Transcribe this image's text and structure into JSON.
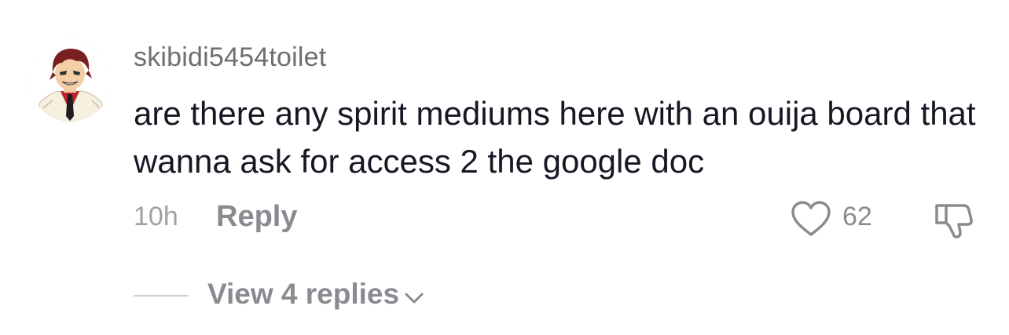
{
  "comment": {
    "username": "skibidi5454toilet",
    "text": "are there any spirit mediums here with an ouija board that wanna ask for access 2 the google doc",
    "time": "10h",
    "reply_label": "Reply",
    "like_count": "62",
    "view_replies_label": "View 4 replies"
  },
  "icons": {
    "avatar": "anime-character-avatar",
    "like": "heart-outline-icon",
    "dislike": "thumbs-down-outline-icon",
    "expand": "chevron-down-icon"
  },
  "colors": {
    "background": "#ffffff",
    "comment_text": "#161823",
    "secondary_text": "#8a8b91",
    "username_text": "#6e6e73"
  }
}
